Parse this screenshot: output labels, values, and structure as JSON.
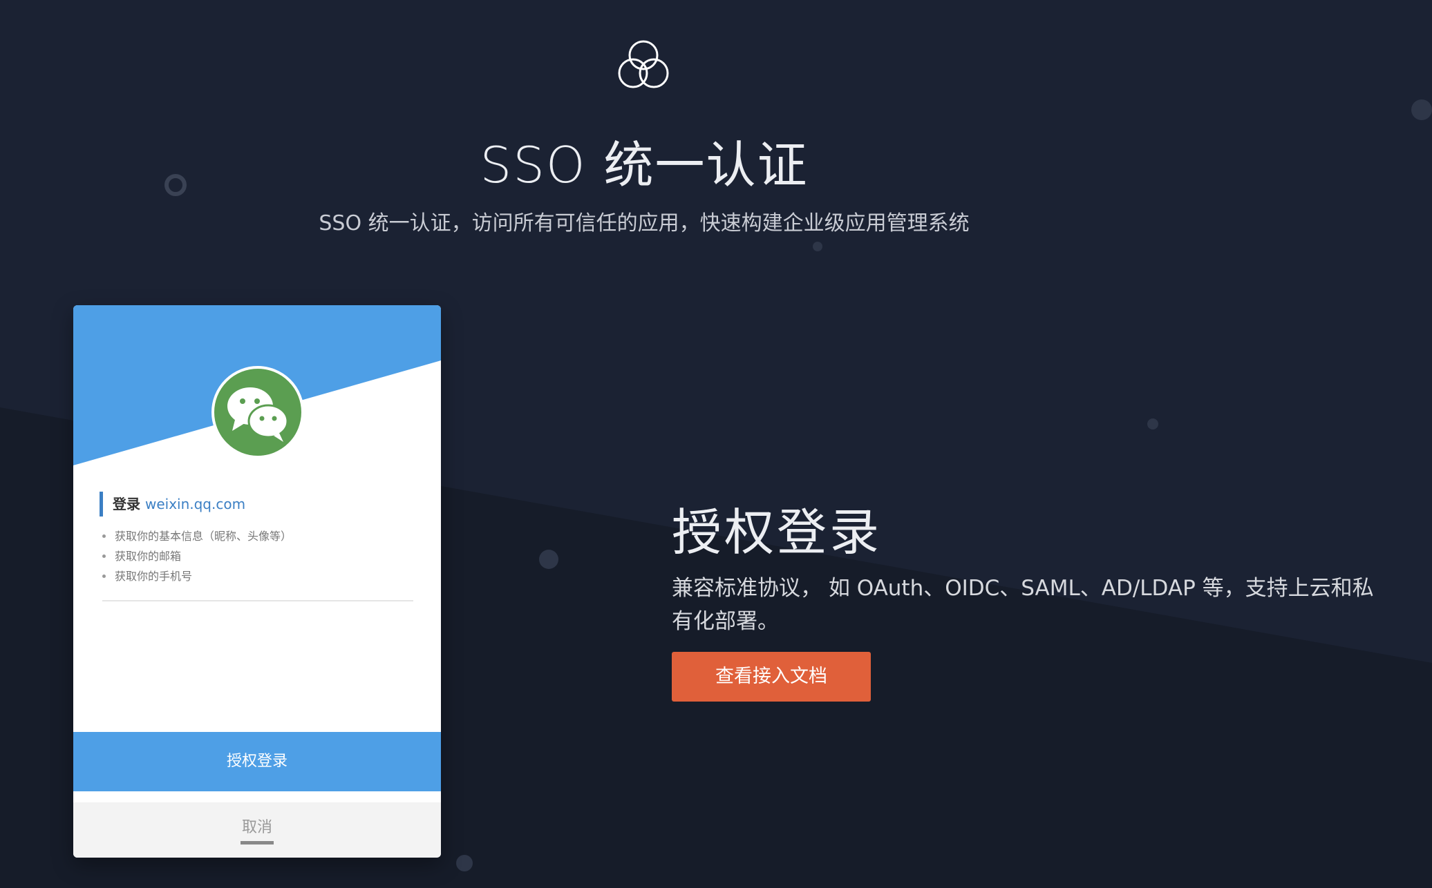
{
  "hero": {
    "icon": "overlapping-circles-icon",
    "title": "SSO 统一认证",
    "subtitle": "SSO 统一认证，访问所有可信任的应用，快速构建企业级应用管理系统"
  },
  "auth_card": {
    "icon": "wechat-icon",
    "login_prefix": "登录",
    "login_domain": "weixin.qq.com",
    "permissions": [
      "获取你的基本信息（昵称、头像等）",
      "获取你的邮箱",
      "获取你的手机号"
    ],
    "authorize_label": "授权登录",
    "cancel_label": "取消"
  },
  "feature": {
    "title": "授权登录",
    "description": "兼容标准协议， 如 OAuth、OIDC、SAML、AD/LDAP 等，支持上云和私有化部署。",
    "button_label": "查看接入文档"
  },
  "colors": {
    "background": "#1b2233",
    "card_blue": "#4e9fe6",
    "wechat_green": "#5b9e51",
    "primary_button": "#e0603a"
  }
}
